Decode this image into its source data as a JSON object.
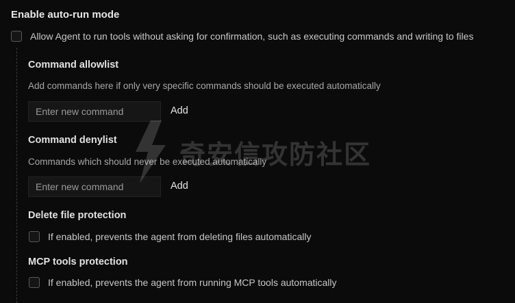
{
  "auto_run": {
    "title": "Enable auto-run mode",
    "checkbox_label": "Allow Agent to run tools without asking for confirmation, such as executing commands and writing to files"
  },
  "allowlist": {
    "title": "Command allowlist",
    "description": "Add commands here if only very specific commands should be executed automatically",
    "placeholder": "Enter new command",
    "add_label": "Add"
  },
  "denylist": {
    "title": "Command denylist",
    "description": "Commands which should never be executed automatically",
    "placeholder": "Enter new command",
    "add_label": "Add"
  },
  "delete_protection": {
    "title": "Delete file protection",
    "checkbox_label": "If enabled, prevents the agent from deleting files automatically"
  },
  "mcp_protection": {
    "title": "MCP tools protection",
    "checkbox_label": "If enabled, prevents the agent from running MCP tools automatically"
  },
  "watermark": {
    "text": "奇安信攻防社区"
  },
  "icons": {
    "watermark_logo": "lightning-bolt-icon"
  }
}
